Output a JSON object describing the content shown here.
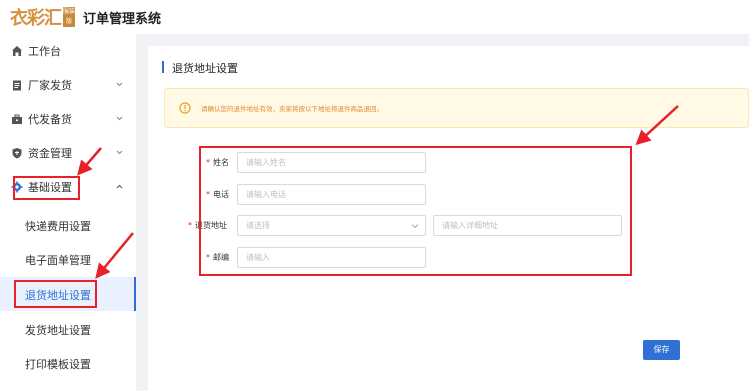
{
  "header": {
    "logo_text": "衣彩汇",
    "logo_badge": "服装版",
    "app_title": "订单管理系统"
  },
  "sidebar": {
    "items": [
      {
        "label": "工作台",
        "icon": "home-icon"
      },
      {
        "label": "厂家发货",
        "icon": "clipboard-icon"
      },
      {
        "label": "代发备货",
        "icon": "briefcase-icon"
      },
      {
        "label": "资金管理",
        "icon": "shield-icon"
      },
      {
        "label": "基础设置",
        "icon": "gear-icon"
      }
    ],
    "sub_items": [
      {
        "label": "快递费用设置"
      },
      {
        "label": "电子面单管理"
      },
      {
        "label": "退货地址设置"
      },
      {
        "label": "发货地址设置"
      },
      {
        "label": "打印模板设置"
      }
    ]
  },
  "main": {
    "title": "退货地址设置",
    "alert_text": "请确认您的退件地址有效，卖家将按以下地址将退件商品退回。",
    "form": {
      "name_label": "姓名",
      "name_placeholder": "请输入姓名",
      "phone_label": "电话",
      "phone_placeholder": "请输入电话",
      "address_label": "退货地址",
      "region_placeholder": "请选择",
      "detail_placeholder": "请输入详细地址",
      "zip_label": "邮编",
      "zip_placeholder": "请输入"
    },
    "save_label": "保存"
  },
  "colors": {
    "accent": "#2f6fd6",
    "brand": "#d3913c",
    "annotation": "#e8202a",
    "alert_bg": "#fff9e6",
    "alert_text": "#e08a2c"
  }
}
